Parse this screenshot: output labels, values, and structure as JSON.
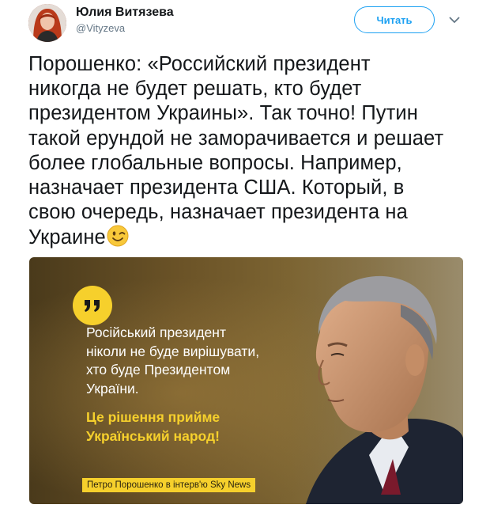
{
  "author": {
    "name": "Юлия Витязева",
    "handle": "@Vityzeva"
  },
  "actions": {
    "follow_label": "Читать",
    "more_icon": "chevron-down-icon"
  },
  "tweet": {
    "text": "Порошенко: «Российский президент\nникогда не будет решать, кто будет\nпрезидентом Украины». Так точно! Путин\nтакой ерундой не заморачивается и решает\nболее глобальные вопросы. Например,\nназначает президента США.  Который, в\nсвою очередь, назначает президента на\nУкраине",
    "emoji": "winking-face"
  },
  "media": {
    "quote_text": "Російський президент\nніколи не буде вирішувати,\nхто буде Президентом\nУкраїни.",
    "quote_bold": "Це рішення прийме\nУкраїнський народ!",
    "caption": "Петро Порошенко в інтерв'ю Sky News",
    "accent_color": "#f6d02c"
  },
  "colors": {
    "link_blue": "#1da1f2",
    "handle_gray": "#657786"
  }
}
